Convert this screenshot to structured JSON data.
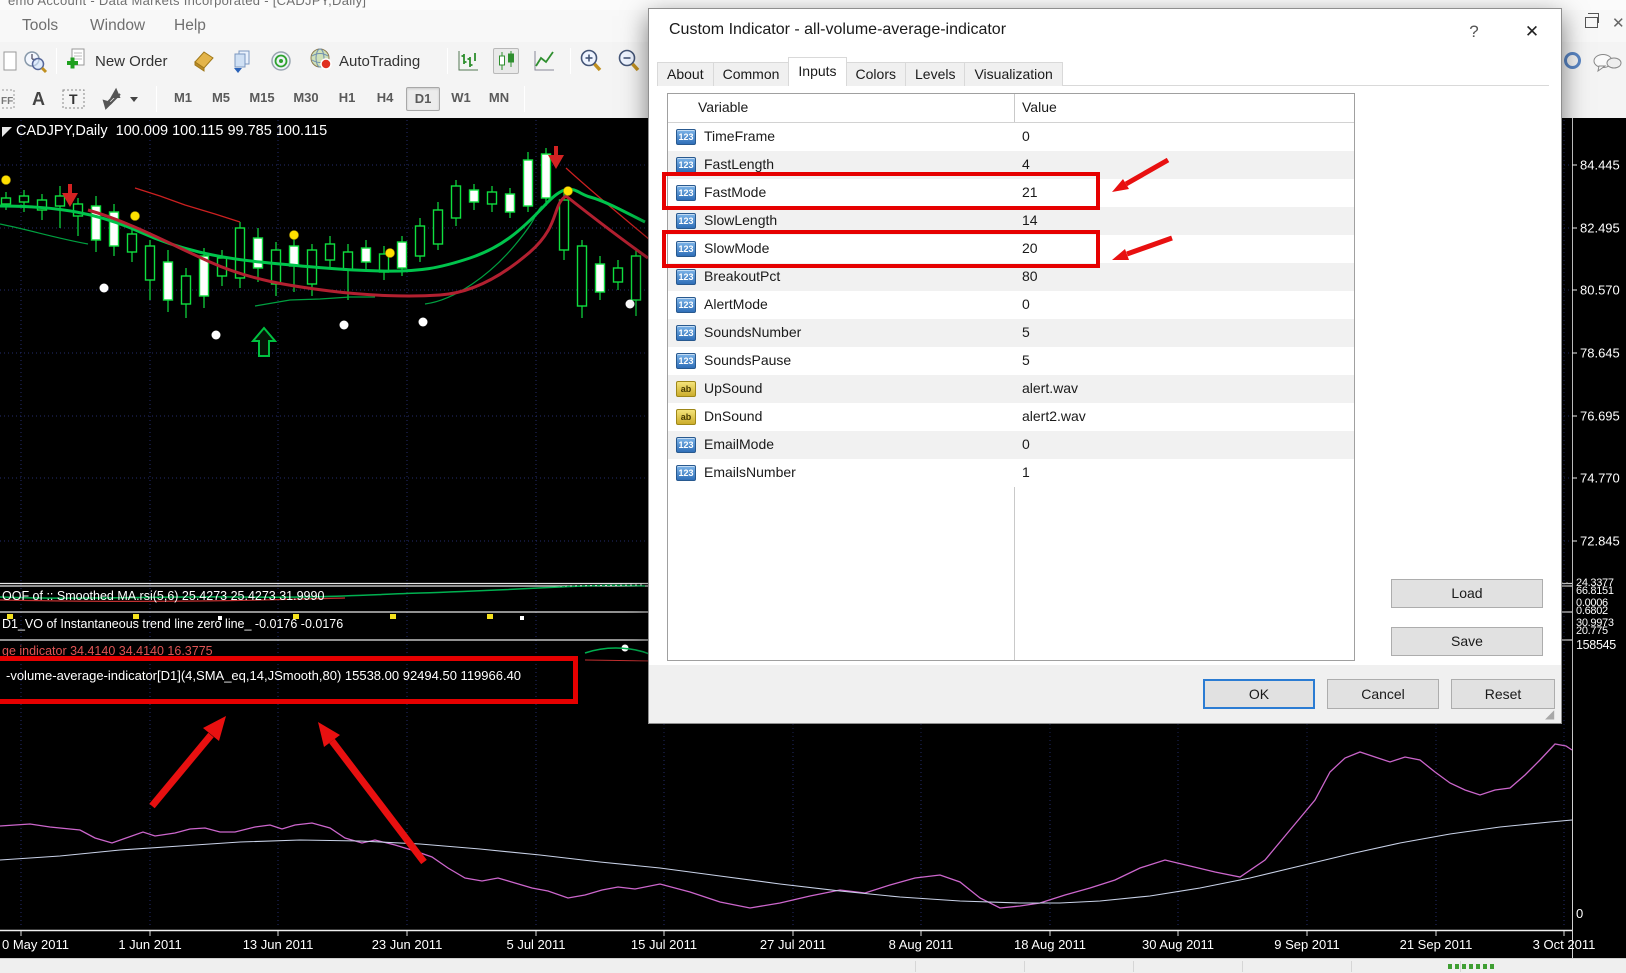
{
  "window": {
    "title_fragment": "emo Account - Data Markets Incorporated - [CADJPY,Daily]",
    "menu_items": [
      "Tools",
      "Window",
      "Help"
    ]
  },
  "toolbar": {
    "new_order_label": "New Order",
    "autotrading_label": "AutoTrading",
    "timeframes": [
      "M1",
      "M5",
      "M15",
      "M30",
      "H1",
      "H4",
      "D1",
      "W1",
      "MN"
    ],
    "active_timeframe": "D1",
    "text_icon_label": "A",
    "text_box_icon_label": "T"
  },
  "chart": {
    "symbol_line": "CADJPY,Daily  100.009 100.115 99.785 100.115",
    "price_labels": [
      "84.445",
      "82.495",
      "80.570",
      "78.645",
      "76.695",
      "74.770",
      "72.845"
    ],
    "sub_scale_labels": [
      "24.3377",
      "66.8151",
      "0.0006",
      "0.6802",
      "30.9973",
      "20.775"
    ],
    "volume_scale_label": "158545",
    "volume_zero_label": "0",
    "date_labels": [
      "0 May 2011",
      "1 Jun 2011",
      "13 Jun 2011",
      "23 Jun 2011",
      "5 Jul 2011",
      "15 Jul 2011",
      "27 Jul 2011",
      "8 Aug 2011",
      "18 Aug 2011",
      "30 Aug 2011",
      "9 Sep 2011",
      "21 Sep 2011",
      "3 Oct 2011"
    ],
    "indicator_labels": {
      "smoothed_ma": "OOF of :: Smoothed MA.rsi(5,6) 25.4273 25.4273 31.9990",
      "trend_line": "D1_VO of Instantaneous trend line zero line_  -0.0176 -0.0176",
      "partial_red": "ge indicator  34.4140  34.4140  16.3775",
      "volume_average": "-volume-average-indicator[D1](4,SMA_eq,14,JSmooth,80) 15538.00 92494.50 119966.40"
    }
  },
  "dialog": {
    "title": "Custom Indicator - all-volume-average-indicator",
    "help_glyph": "?",
    "close_glyph": "✕",
    "tabs": [
      "About",
      "Common",
      "Inputs",
      "Colors",
      "Levels",
      "Visualization"
    ],
    "active_tab": "Inputs",
    "table": {
      "col_variable": "Variable",
      "col_value": "Value",
      "rows": [
        {
          "icon": "123",
          "name": "TimeFrame",
          "value": "0"
        },
        {
          "icon": "123",
          "name": "FastLength",
          "value": "4"
        },
        {
          "icon": "123",
          "name": "FastMode",
          "value": "21"
        },
        {
          "icon": "123",
          "name": "SlowLength",
          "value": "14"
        },
        {
          "icon": "123",
          "name": "SlowMode",
          "value": "20"
        },
        {
          "icon": "123",
          "name": "BreakoutPct",
          "value": "80"
        },
        {
          "icon": "123",
          "name": "AlertMode",
          "value": "0"
        },
        {
          "icon": "123",
          "name": "SoundsNumber",
          "value": "5"
        },
        {
          "icon": "123",
          "name": "SoundsPause",
          "value": "5"
        },
        {
          "icon": "ab",
          "name": "UpSound",
          "value": "alert.wav"
        },
        {
          "icon": "ab",
          "name": "DnSound",
          "value": "alert2.wav"
        },
        {
          "icon": "123",
          "name": "EmailMode",
          "value": "0"
        },
        {
          "icon": "123",
          "name": "EmailsNumber",
          "value": "1"
        }
      ]
    },
    "buttons": {
      "load": "Load",
      "save": "Save",
      "ok": "OK",
      "cancel": "Cancel",
      "reset": "Reset"
    }
  },
  "colors": {
    "highlight_red": "#e60000",
    "accent_blue": "#2b7cd3",
    "bull_green": "#0fdf3f",
    "ma_green": "#00c44c",
    "ma_crimson": "#b22030",
    "violet_line": "#cc66cc",
    "pale_line": "#c9d2e8"
  }
}
